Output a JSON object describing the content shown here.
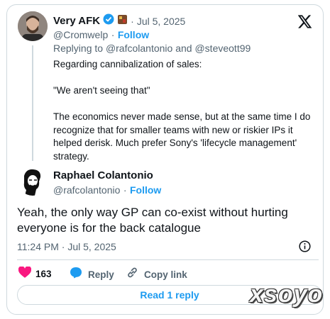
{
  "quoted_tweet": {
    "display_name": "Very AFK",
    "date": "Jul 5, 2025",
    "handle": "@Cromwelp",
    "follow_label": "Follow",
    "replying_prefix": "Replying to",
    "replying_user1": "@rafcolantonio",
    "replying_and": "and",
    "replying_user2": "@steveott99",
    "text": "Regarding cannibalization of sales:\n\n\"We aren't seeing that\"\n\nThe economics never made sense, but at the same time I do\nrecognize that for smaller teams with new or riskier IPs it\nhelped derisk. Much prefer Sony's 'lifecycle management'\nstrategy."
  },
  "reply_tweet": {
    "display_name": "Raphael Colantonio",
    "handle": "@rafcolantonio",
    "follow_label": "Follow",
    "text_line1": "Yeah, the only way GP can co-exist without hurting",
    "text_line2": "everyone is for the back catalogue",
    "timestamp": "11:24 PM · Jul 5, 2025"
  },
  "actions": {
    "like_count": "163",
    "reply_label": "Reply",
    "copy_link_label": "Copy link"
  },
  "read_replies_label": "Read 1 reply",
  "watermark": "xsoyo",
  "icons": [
    "x-logo-icon",
    "verified-badge-icon",
    "like-heart-icon",
    "reply-bubble-icon",
    "link-icon",
    "info-icon"
  ],
  "colors": {
    "accent": "#1d9bf0",
    "like": "#f91880",
    "muted": "#536471",
    "border": "#cfd9de"
  }
}
